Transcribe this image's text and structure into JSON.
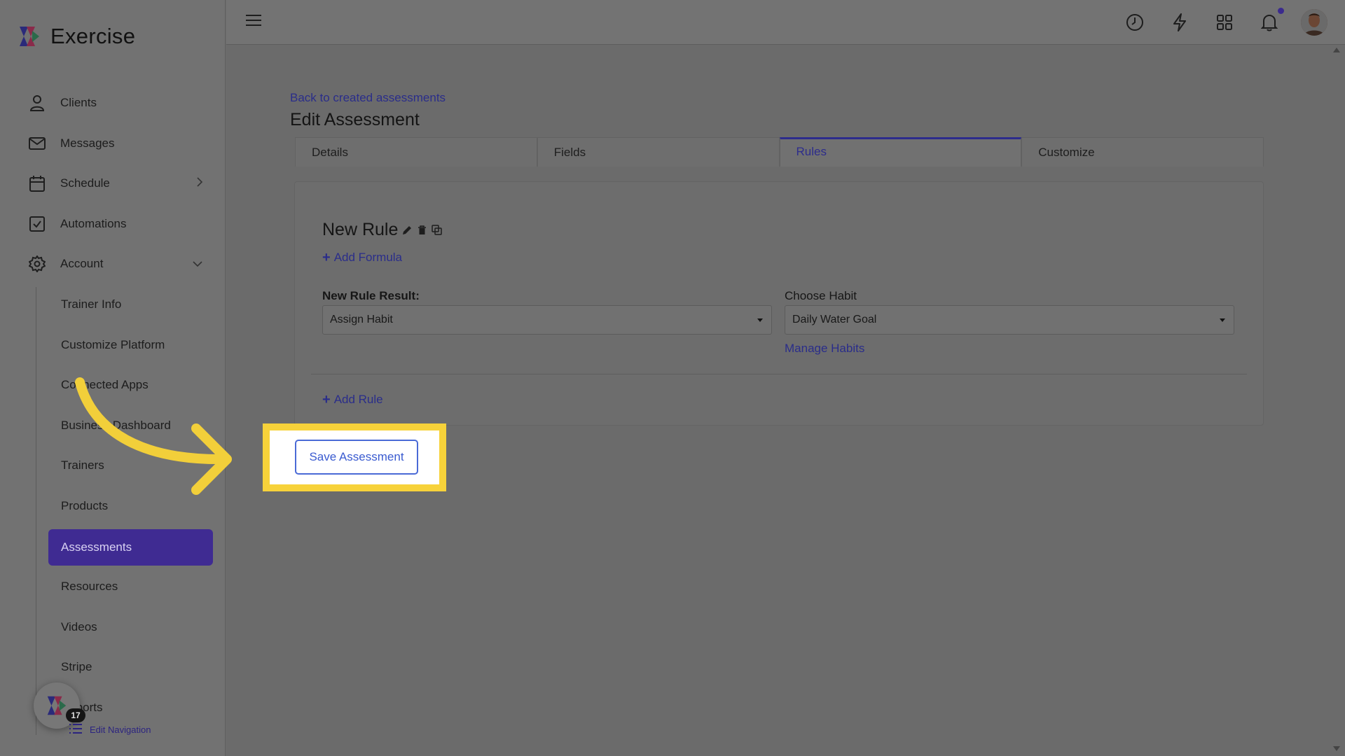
{
  "app": {
    "name": "Exercise"
  },
  "sidebar": {
    "items": [
      {
        "label": "Clients",
        "icon": "user-icon"
      },
      {
        "label": "Messages",
        "icon": "mail-icon"
      },
      {
        "label": "Schedule",
        "icon": "calendar-icon"
      },
      {
        "label": "Automations",
        "icon": "checkbox-icon"
      },
      {
        "label": "Account",
        "icon": "gear-icon"
      }
    ],
    "account_sub": [
      "Trainer Info",
      "Customize Platform",
      "Connected Apps",
      "Business Dashboard",
      "Trainers",
      "Products",
      "Assessments",
      "Resources",
      "Videos",
      "Stripe",
      "Reports"
    ],
    "active": "Assessments",
    "badge_count": "17",
    "edit_navigation": "Edit Navigation"
  },
  "topbar": {
    "icons": [
      "history-icon",
      "lightning-icon",
      "grid-icon",
      "bell-icon"
    ]
  },
  "main": {
    "back_link": "Back to created assessments",
    "title": "Edit Assessment",
    "tabs": [
      "Details",
      "Fields",
      "Rules",
      "Customize"
    ],
    "active_tab": "Rules",
    "rule": {
      "name": "New Rule",
      "add_formula": "Add Formula",
      "result_label": "New Rule Result:",
      "result_value": "Assign Habit",
      "habit_label": "Choose Habit",
      "habit_value": "Daily Water Goal",
      "manage_habits": "Manage Habits"
    },
    "add_rule": "Add Rule",
    "save_button": "Save Assessment"
  },
  "colors": {
    "accent": "#2d2c8c",
    "active_nav": "#3f2b92",
    "highlight": "#f7d23a",
    "button_border": "#4a6ad6"
  }
}
